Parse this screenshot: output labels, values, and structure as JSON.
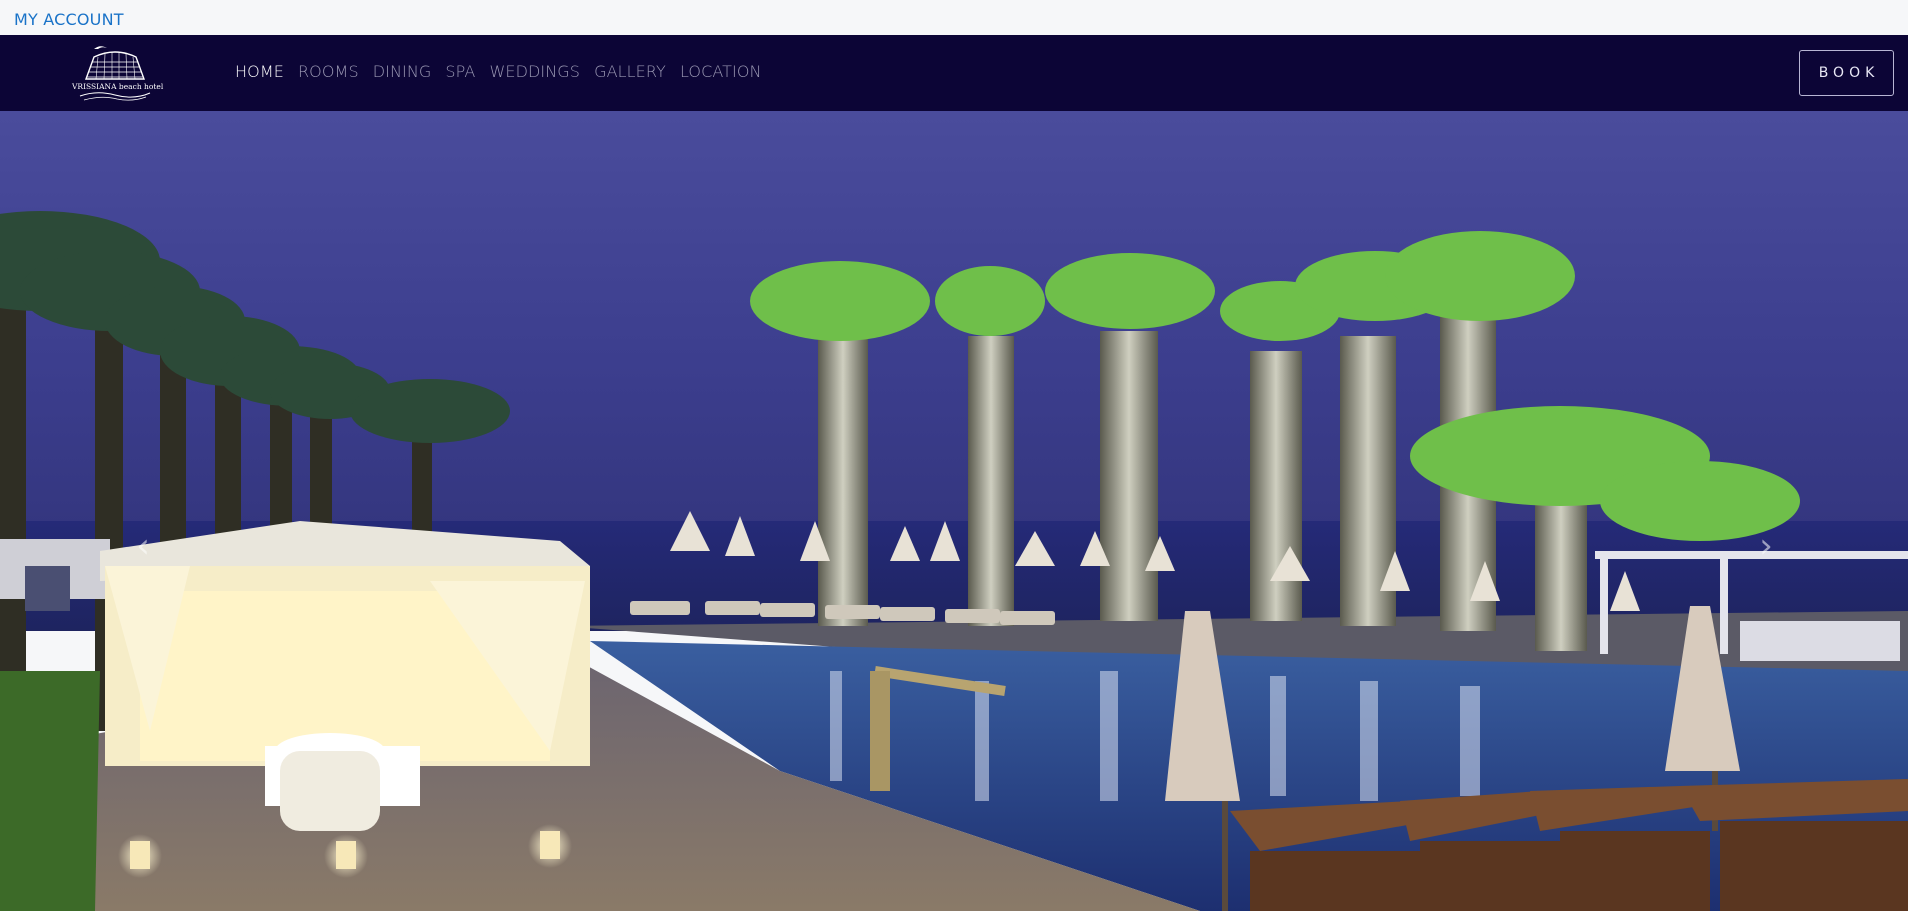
{
  "topbar": {
    "account_link": "MY ACCOUNT"
  },
  "header": {
    "logo_text": "VRISSIANA beach hotel",
    "nav": [
      {
        "label": "HOME",
        "active": true
      },
      {
        "label": "ROOMS",
        "active": false
      },
      {
        "label": "DINING",
        "active": false
      },
      {
        "label": "SPA",
        "active": false
      },
      {
        "label": "WEDDINGS",
        "active": false
      },
      {
        "label": "GALLERY",
        "active": false
      },
      {
        "label": "LOCATION",
        "active": false
      }
    ],
    "book_label": "BOOK"
  },
  "hero": {
    "prev_icon": "chevron-left-icon",
    "next_icon": "chevron-right-icon"
  },
  "colors": {
    "navbar_bg": "#0c0536",
    "link_blue": "#1a73c8",
    "nav_inactive": "#9a98b3",
    "nav_active": "#ffffff"
  }
}
